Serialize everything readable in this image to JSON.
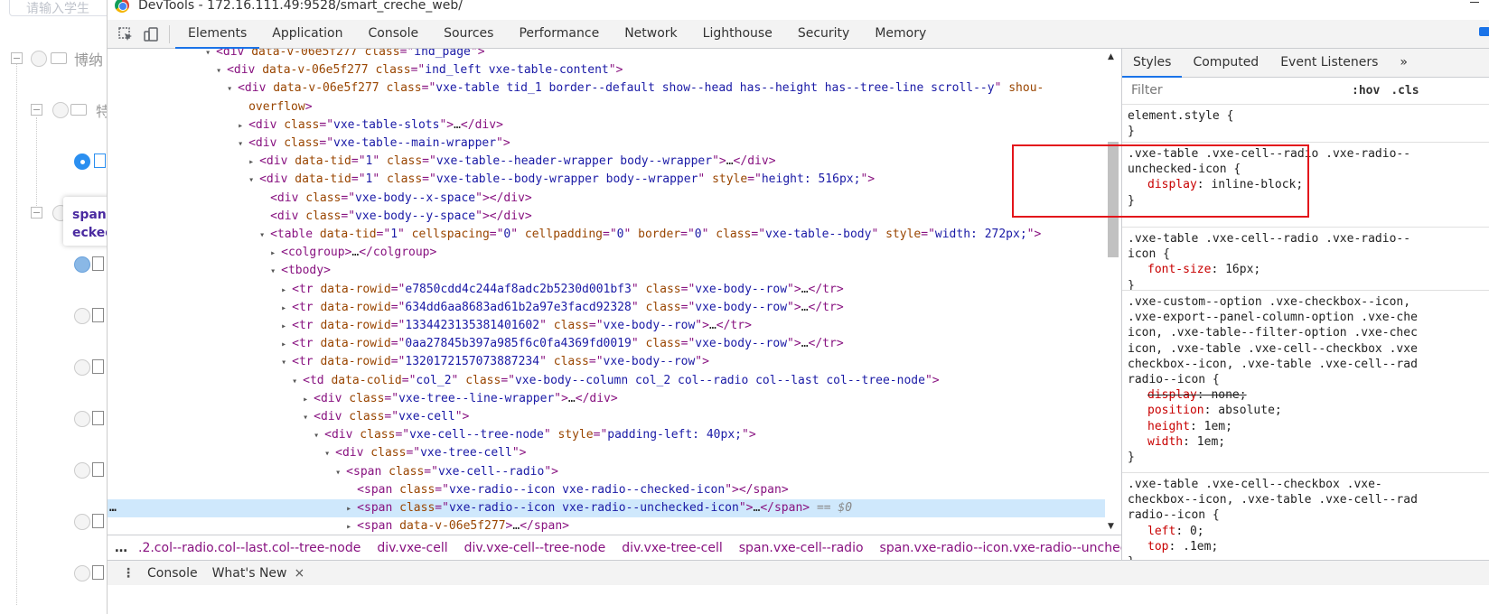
{
  "background_page": {
    "search_placeholder": "请输入学生",
    "tree_labels": [
      "博纳",
      "特"
    ],
    "tooltip_line1": "span.",
    "tooltip_line2": "ecked"
  },
  "window": {
    "title": "DevTools - 172.16.111.49:9528/smart_creche_web/"
  },
  "tabs": [
    "Elements",
    "Application",
    "Console",
    "Sources",
    "Performance",
    "Network",
    "Lighthouse",
    "Security",
    "Memory"
  ],
  "elements_lines": [
    {
      "indent": 10,
      "tri": "▾",
      "html": "<div data-v-06e5f277 class=\"ind_page\">"
    },
    {
      "indent": 11,
      "tri": "▾",
      "html": "<div data-v-06e5f277 class=\"ind_left vxe-table-content\">"
    },
    {
      "indent": 12,
      "tri": "▾",
      "html": "<div data-v-06e5f277 class=\"vxe-table tid_1 border--default show--head has--height has--tree-line scroll--y\" shou-"
    },
    {
      "indent": 13,
      "tri": "",
      "html": "overflow>"
    },
    {
      "indent": 13,
      "tri": "▸",
      "html": "<div class=\"vxe-table-slots\">…</div>"
    },
    {
      "indent": 13,
      "tri": "▾",
      "html": "<div class=\"vxe-table--main-wrapper\">"
    },
    {
      "indent": 14,
      "tri": "▸",
      "html": "<div data-tid=\"1\" class=\"vxe-table--header-wrapper body--wrapper\">…</div>"
    },
    {
      "indent": 14,
      "tri": "▾",
      "html": "<div data-tid=\"1\" class=\"vxe-table--body-wrapper body--wrapper\" style=\"height: 516px;\">"
    },
    {
      "indent": 15,
      "tri": "",
      "html": "<div class=\"vxe-body--x-space\"></div>"
    },
    {
      "indent": 15,
      "tri": "",
      "html": "<div class=\"vxe-body--y-space\"></div>"
    },
    {
      "indent": 15,
      "tri": "▾",
      "html": "<table data-tid=\"1\" cellspacing=\"0\" cellpadding=\"0\" border=\"0\" class=\"vxe-table--body\" style=\"width: 272px;\">"
    },
    {
      "indent": 16,
      "tri": "▸",
      "html": "<colgroup>…</colgroup>"
    },
    {
      "indent": 16,
      "tri": "▾",
      "html": "<tbody>"
    },
    {
      "indent": 17,
      "tri": "▸",
      "html": "<tr data-rowid=\"e7850cdd4c244af8adc2b5230d001bf3\" class=\"vxe-body--row\">…</tr>"
    },
    {
      "indent": 17,
      "tri": "▸",
      "html": "<tr data-rowid=\"634dd6aa8683ad61b2a97e3facd92328\" class=\"vxe-body--row\">…</tr>"
    },
    {
      "indent": 17,
      "tri": "▸",
      "html": "<tr data-rowid=\"1334423135381401602\" class=\"vxe-body--row\">…</tr>"
    },
    {
      "indent": 17,
      "tri": "▸",
      "html": "<tr data-rowid=\"0aa27845b397a985f6c0fa4369fd0019\" class=\"vxe-body--row\">…</tr>"
    },
    {
      "indent": 17,
      "tri": "▾",
      "html": "<tr data-rowid=\"1320172157073887234\" class=\"vxe-body--row\">"
    },
    {
      "indent": 18,
      "tri": "▾",
      "html": "<td data-colid=\"col_2\" class=\"vxe-body--column col_2 col--radio col--last col--tree-node\">"
    },
    {
      "indent": 19,
      "tri": "▸",
      "html": "<div class=\"vxe-tree--line-wrapper\">…</div>"
    },
    {
      "indent": 19,
      "tri": "▾",
      "html": "<div class=\"vxe-cell\">"
    },
    {
      "indent": 20,
      "tri": "▾",
      "html": "<div class=\"vxe-cell--tree-node\" style=\"padding-left: 40px;\">"
    },
    {
      "indent": 21,
      "tri": "▾",
      "html": "<div class=\"vxe-tree-cell\">"
    },
    {
      "indent": 22,
      "tri": "▾",
      "html": "<span class=\"vxe-cell--radio\">"
    },
    {
      "indent": 23,
      "tri": "",
      "html": "<span class=\"vxe-radio--icon vxe-radio--checked-icon\"></span>"
    },
    {
      "indent": 23,
      "tri": "▸",
      "html": "<span class=\"vxe-radio--icon vxe-radio--unchecked-icon\">…</span>",
      "selected": true,
      "suffix": " == $0"
    },
    {
      "indent": 23,
      "tri": "▸",
      "html": "<span data-v-06e5f277>…</span>"
    }
  ],
  "selected_marker": "…",
  "breadcrumbs": [
    ".2.col--radio.col--last.col--tree-node",
    "div.vxe-cell",
    "div.vxe-cell--tree-node",
    "div.vxe-tree-cell",
    "span.vxe-cell--radio",
    "span.vxe-radio--icon.vxe-radio--unchecked-icon"
  ],
  "breadcrumb_more": "…",
  "styles_tabs": [
    "Styles",
    "Computed",
    "Event Listeners"
  ],
  "styles_more": "»",
  "filter_placeholder": "Filter",
  "hov_label": ":hov",
  "cls_label": ".cls",
  "rules": [
    {
      "selector": "element.style {",
      "props": [],
      "close": "}"
    },
    {
      "selector": ".vxe-table .vxe-cell--radio .vxe-radio--\nunchecked-icon {",
      "props": [
        {
          "name": "display",
          "value": "inline-block;",
          "strike": false
        }
      ],
      "close": "}"
    },
    {
      "selector": ".vxe-table .vxe-cell--radio .vxe-radio--\nicon {",
      "props": [
        {
          "name": "font-size",
          "value": "16px;",
          "strike": false
        }
      ],
      "close": "}"
    },
    {
      "selector": ".vxe-custom--option .vxe-checkbox--icon,\n.vxe-export--panel-column-option .vxe-che\nicon, .vxe-table--filter-option .vxe-chec\nicon, .vxe-table .vxe-cell--checkbox .vxe\ncheckbox--icon, .vxe-table .vxe-cell--rad\nradio--icon {",
      "props": [
        {
          "name": "display",
          "value": "none;",
          "strike": true
        },
        {
          "name": "position",
          "value": "absolute;",
          "strike": false
        },
        {
          "name": "height",
          "value": "1em;",
          "strike": false
        },
        {
          "name": "width",
          "value": "1em;",
          "strike": false
        }
      ],
      "close": "}"
    },
    {
      "selector": ".vxe-table .vxe-cell--checkbox .vxe-\ncheckbox--icon, .vxe-table .vxe-cell--rad\nradio--icon {",
      "props": [
        {
          "name": "left",
          "value": "0;",
          "strike": false
        },
        {
          "name": "top",
          "value": ".1em;",
          "strike": false
        }
      ],
      "close": "}"
    }
  ],
  "drawer_tabs": [
    "Console",
    "What's New"
  ],
  "drawer_close": "×",
  "colors": {
    "accent": "#1a73e8",
    "highlight_box": "#e3141b",
    "tag": "#881280",
    "attr_name": "#994500",
    "attr_value": "#1a1aa6"
  }
}
